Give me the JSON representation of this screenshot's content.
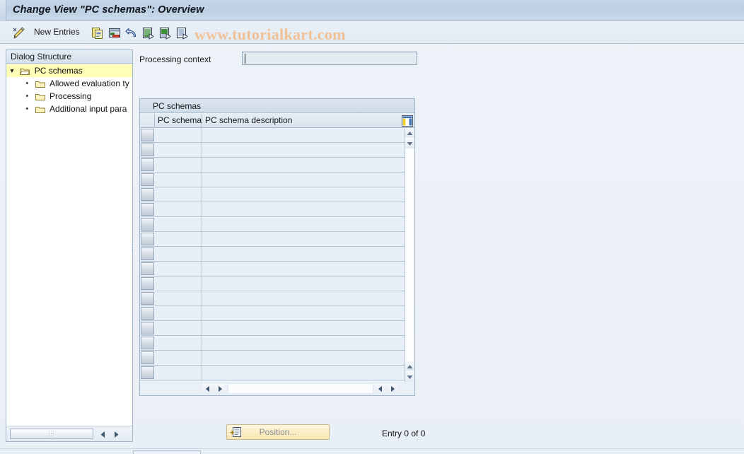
{
  "window": {
    "title": "Change View \"PC schemas\": Overview"
  },
  "toolbar": {
    "pencil_icon": "pencil-icon",
    "new_entries_label": "New Entries",
    "icons": [
      {
        "name": "copy-icon",
        "title": "Copy As..."
      },
      {
        "name": "delete-icon",
        "title": "Delete"
      },
      {
        "name": "undo-icon",
        "title": "Undo Change"
      },
      {
        "name": "select-all-icon",
        "title": "Select All"
      },
      {
        "name": "select-block-icon",
        "title": "Select Block"
      },
      {
        "name": "deselect-all-icon",
        "title": "Deselect All"
      }
    ]
  },
  "watermark": {
    "text": "www.tutorialkart.com",
    "color": "#f0c196"
  },
  "sidebar": {
    "header": "Dialog Structure",
    "items": [
      {
        "label": "PC schemas",
        "level": 0,
        "expanded": true,
        "selected": true,
        "icon": "folder-open-icon"
      },
      {
        "label": "Allowed evaluation ty",
        "level": 1,
        "expanded": false,
        "selected": false,
        "icon": "folder-icon"
      },
      {
        "label": "Processing",
        "level": 1,
        "expanded": false,
        "selected": false,
        "icon": "folder-icon"
      },
      {
        "label": "Additional input para",
        "level": 1,
        "expanded": false,
        "selected": false,
        "icon": "folder-icon"
      }
    ],
    "footer": {
      "resize_handle": "resize-grip",
      "left_arrow": "◄",
      "right_arrow": "►"
    }
  },
  "main": {
    "processing_context": {
      "label": "Processing context",
      "value": "",
      "placeholder": ""
    },
    "table": {
      "title": "PC schemas",
      "config_icon": "table-settings-icon",
      "columns": [
        {
          "key": "selector",
          "label": ""
        },
        {
          "key": "pc_schema",
          "label": "PC schema"
        },
        {
          "key": "pc_schema_description",
          "label": "PC schema description"
        }
      ],
      "rows": [],
      "empty_row_count": 17,
      "vscroll": {
        "up_arrow": "▲",
        "down_arrow": "▼"
      },
      "hscroll": {
        "left_arrow": "◄",
        "right_arrow": "►"
      }
    }
  },
  "footer": {
    "position_button": {
      "label": "Position...",
      "icon": "position-icon",
      "enabled": false
    },
    "entry_count": "Entry 0 of 0"
  }
}
